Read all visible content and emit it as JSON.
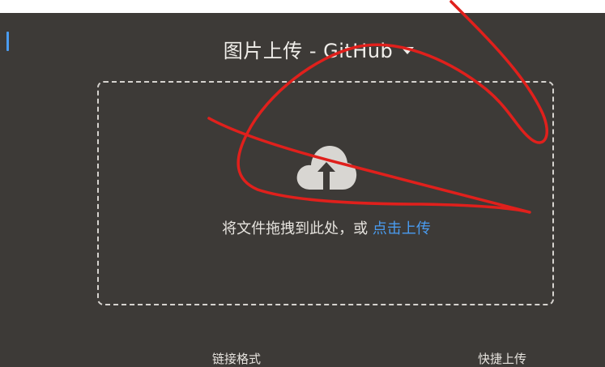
{
  "header": {
    "title": "图片上传 - GitHub"
  },
  "dropzone": {
    "instruction": "将文件拖拽到此处，或",
    "upload_link": "点击上传"
  },
  "footer": {
    "link_format_label": "链接格式",
    "quick_upload_label": "快捷上传"
  },
  "colors": {
    "background": "#3d3a37",
    "accent": "#4a9cf0",
    "annotation": "#e0201c"
  }
}
